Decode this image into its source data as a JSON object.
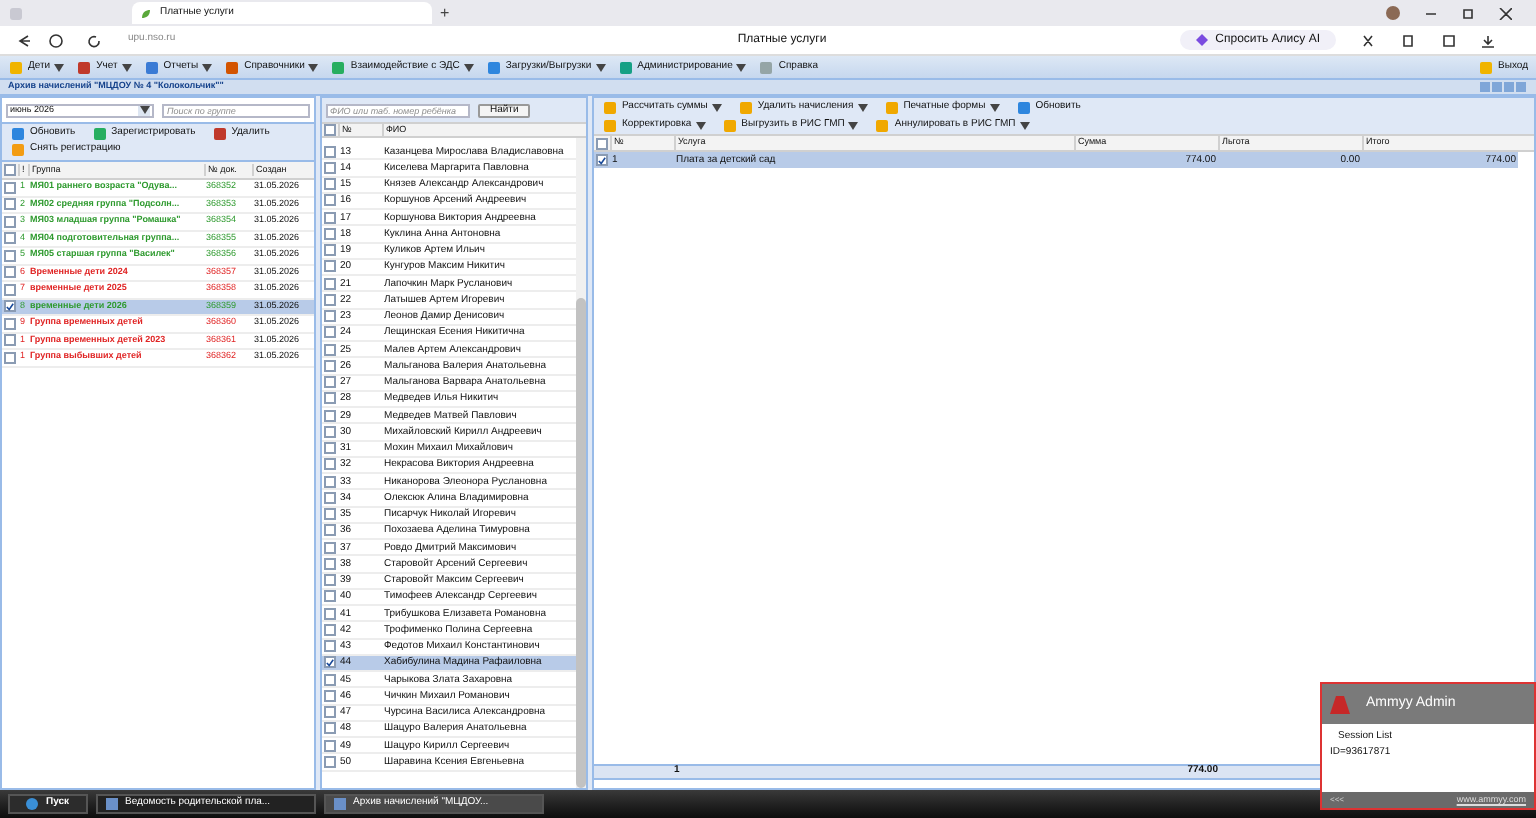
{
  "browser": {
    "new_tab": "+",
    "tab_title": "Платные услуги",
    "url": "upu.nso.ru",
    "page_title": "Платные услуги",
    "ask_button": "Спросить Алису AI"
  },
  "menu": {
    "items": [
      {
        "label": "Дети",
        "dropdown": true
      },
      {
        "label": "Учет",
        "dropdown": true
      },
      {
        "label": "Отчеты",
        "dropdown": true
      },
      {
        "label": "Справочники",
        "dropdown": true
      },
      {
        "label": "Взаимодействие с ЭДС",
        "dropdown": true
      },
      {
        "label": "Загрузки/Выгрузки",
        "dropdown": true
      },
      {
        "label": "Администрирование",
        "dropdown": true
      },
      {
        "label": "Справка",
        "dropdown": false
      }
    ],
    "exit": "Выход"
  },
  "window": {
    "title": "Архив начислений \"МЦДОУ № 4 \"Колокольчик\"\""
  },
  "groups_panel": {
    "month": "июнь 2026",
    "search_placeholder": "Поиск по группе",
    "buttons": [
      "Обновить",
      "Зарегистрировать",
      "Удалить",
      "Снять регистрацию"
    ],
    "columns": [
      "!",
      "Группа",
      "№ док.",
      "Создан"
    ],
    "all_checked": false,
    "rows": [
      {
        "mark": "1",
        "name": "МЯ01 раннего возраста \"Одува...",
        "doc": "368352",
        "created": "31.05.2026",
        "color": "#2e9a2e",
        "checked": false,
        "selected": false
      },
      {
        "mark": "2",
        "name": "МЯ02 средняя группа \"Подсолн...",
        "doc": "368353",
        "created": "31.05.2026",
        "color": "#2e9a2e",
        "checked": false,
        "selected": false
      },
      {
        "mark": "3",
        "name": "МЯ03 младшая группа \"Ромашка\"",
        "doc": "368354",
        "created": "31.05.2026",
        "color": "#2e9a2e",
        "checked": false,
        "selected": false
      },
      {
        "mark": "4",
        "name": "МЯ04 подготовительная группа...",
        "doc": "368355",
        "created": "31.05.2026",
        "color": "#2e9a2e",
        "checked": false,
        "selected": false
      },
      {
        "mark": "5",
        "name": "МЯ05 старшая группа \"Василек\"",
        "doc": "368356",
        "created": "31.05.2026",
        "color": "#2e9a2e",
        "checked": false,
        "selected": false
      },
      {
        "mark": "6",
        "name": "Временные дети 2024",
        "doc": "368357",
        "created": "31.05.2026",
        "color": "#e02424",
        "checked": false,
        "selected": false
      },
      {
        "mark": "7",
        "name": "временные дети 2025",
        "doc": "368358",
        "created": "31.05.2026",
        "color": "#e02424",
        "checked": false,
        "selected": false
      },
      {
        "mark": "8",
        "name": "временные дети 2026",
        "doc": "368359",
        "created": "31.05.2026",
        "color": "#2e9a2e",
        "checked": true,
        "selected": true
      },
      {
        "mark": "9",
        "name": "Группа временных детей",
        "doc": "368360",
        "created": "31.05.2026",
        "color": "#e02424",
        "checked": false,
        "selected": false
      },
      {
        "mark": "1",
        "name": "Группа временных детей 2023",
        "doc": "368361",
        "created": "31.05.2026",
        "color": "#e02424",
        "checked": false,
        "selected": false
      },
      {
        "mark": "1",
        "name": "Группа выбывших детей",
        "doc": "368362",
        "created": "31.05.2026",
        "color": "#e02424",
        "checked": false,
        "selected": false
      }
    ]
  },
  "children_panel": {
    "search_placeholder": "ФИО или таб. номер ребёнка",
    "find_button": "Найти",
    "columns": [
      "№",
      "ФИО"
    ],
    "all_checked": false,
    "rows": [
      {
        "num": "13",
        "name": "Казанцева Мирослава Владиславовна",
        "selected": false
      },
      {
        "num": "14",
        "name": "Киселева Маргарита Павловна",
        "selected": false
      },
      {
        "num": "15",
        "name": "Князев Александр Александрович",
        "selected": false
      },
      {
        "num": "16",
        "name": "Коршунов Арсений Андреевич",
        "selected": false
      },
      {
        "num": "17",
        "name": "Коршунова Виктория Андреевна",
        "selected": false
      },
      {
        "num": "18",
        "name": "Куклина Анна Антоновна",
        "selected": false
      },
      {
        "num": "19",
        "name": "Куликов Артем Ильич",
        "selected": false
      },
      {
        "num": "20",
        "name": "Кунгуров Максим Никитич",
        "selected": false
      },
      {
        "num": "21",
        "name": "Лапочкин Марк Русланович",
        "selected": false
      },
      {
        "num": "22",
        "name": "Латышев Артем Игоревич",
        "selected": false
      },
      {
        "num": "23",
        "name": "Леонов Дамир Денисович",
        "selected": false
      },
      {
        "num": "24",
        "name": "Лещинская Есения Никитична",
        "selected": false
      },
      {
        "num": "25",
        "name": "Малев Артем Александрович",
        "selected": false
      },
      {
        "num": "26",
        "name": "Мальганова Валерия Анатольевна",
        "selected": false
      },
      {
        "num": "27",
        "name": "Мальганова Варвара Анатольевна",
        "selected": false
      },
      {
        "num": "28",
        "name": "Медведев Илья Никитич",
        "selected": false
      },
      {
        "num": "29",
        "name": "Медведев Матвей Павлович",
        "selected": false
      },
      {
        "num": "30",
        "name": "Михайловский Кирилл Андреевич",
        "selected": false
      },
      {
        "num": "31",
        "name": "Мохин Михаил Михайлович",
        "selected": false
      },
      {
        "num": "32",
        "name": "Некрасова Виктория Андреевна",
        "selected": false
      },
      {
        "num": "33",
        "name": "Никанорова Элеонора Руслановна",
        "selected": false
      },
      {
        "num": "34",
        "name": "Олексюк Алина Владимировна",
        "selected": false
      },
      {
        "num": "35",
        "name": "Писарчук Николай Игоревич",
        "selected": false
      },
      {
        "num": "36",
        "name": "Похозаева Аделина Тимуровна",
        "selected": false
      },
      {
        "num": "37",
        "name": "Ровдо Дмитрий Максимович",
        "selected": false
      },
      {
        "num": "38",
        "name": "Старовойт Арсений Сергеевич",
        "selected": false
      },
      {
        "num": "39",
        "name": "Старовойт Максим Сергеевич",
        "selected": false
      },
      {
        "num": "40",
        "name": "Тимофеев Александр Сергеевич",
        "selected": false
      },
      {
        "num": "41",
        "name": "Трибушкова Елизавета Романовна",
        "selected": false
      },
      {
        "num": "42",
        "name": "Трофименко Полина Сергеевна",
        "selected": false
      },
      {
        "num": "43",
        "name": "Федотов Михаил Константинович",
        "selected": false
      },
      {
        "num": "44",
        "name": "Хабибулина Мадина Рафаиловна",
        "selected": true
      },
      {
        "num": "45",
        "name": "Чарыкова Злата Захаровна",
        "selected": false
      },
      {
        "num": "46",
        "name": "Чичкин Михаил Романович",
        "selected": false
      },
      {
        "num": "47",
        "name": "Чурсина Василиса Александровна",
        "selected": false
      },
      {
        "num": "48",
        "name": "Шацуро Валерия Анатольевна",
        "selected": false
      },
      {
        "num": "49",
        "name": "Шацуро Кирилл Сергеевич",
        "selected": false
      },
      {
        "num": "50",
        "name": "Шаравина Ксения Евгеньевна",
        "selected": false
      }
    ]
  },
  "charges_panel": {
    "toolbar_1": [
      {
        "label": "Рассчитать суммы",
        "dropdown": true
      },
      {
        "label": "Удалить начисления",
        "dropdown": true
      },
      {
        "label": "Печатные формы",
        "dropdown": true
      },
      {
        "label": "Обновить",
        "dropdown": false
      }
    ],
    "toolbar_2": [
      {
        "label": "Корректировка",
        "dropdown": true
      },
      {
        "label": "Выгрузить в РИС ГМП",
        "dropdown": true
      },
      {
        "label": "Аннулировать в РИС ГМП",
        "dropdown": true
      }
    ],
    "columns": [
      "№",
      "Услуга",
      "Сумма",
      "Льгота",
      "Итого"
    ],
    "all_checked": false,
    "rows": [
      {
        "num": "1",
        "service": "Плата за детский сад",
        "sum": "774.00",
        "discount": "0.00",
        "total": "774.00",
        "selected": true
      }
    ],
    "footer": {
      "count": "1",
      "sum": "774.00"
    }
  },
  "popup": {
    "title": "Ammyy Admin",
    "session_list": "Session List",
    "id": "ID=93617871",
    "back": "<<<",
    "link": "www.ammyy.com"
  },
  "taskbar": {
    "start": "Пуск",
    "items": [
      {
        "label": "Ведомость родительской пла...",
        "selected": false
      },
      {
        "label": "Архив начислений \"МЦДОУ...",
        "selected": true
      }
    ]
  }
}
